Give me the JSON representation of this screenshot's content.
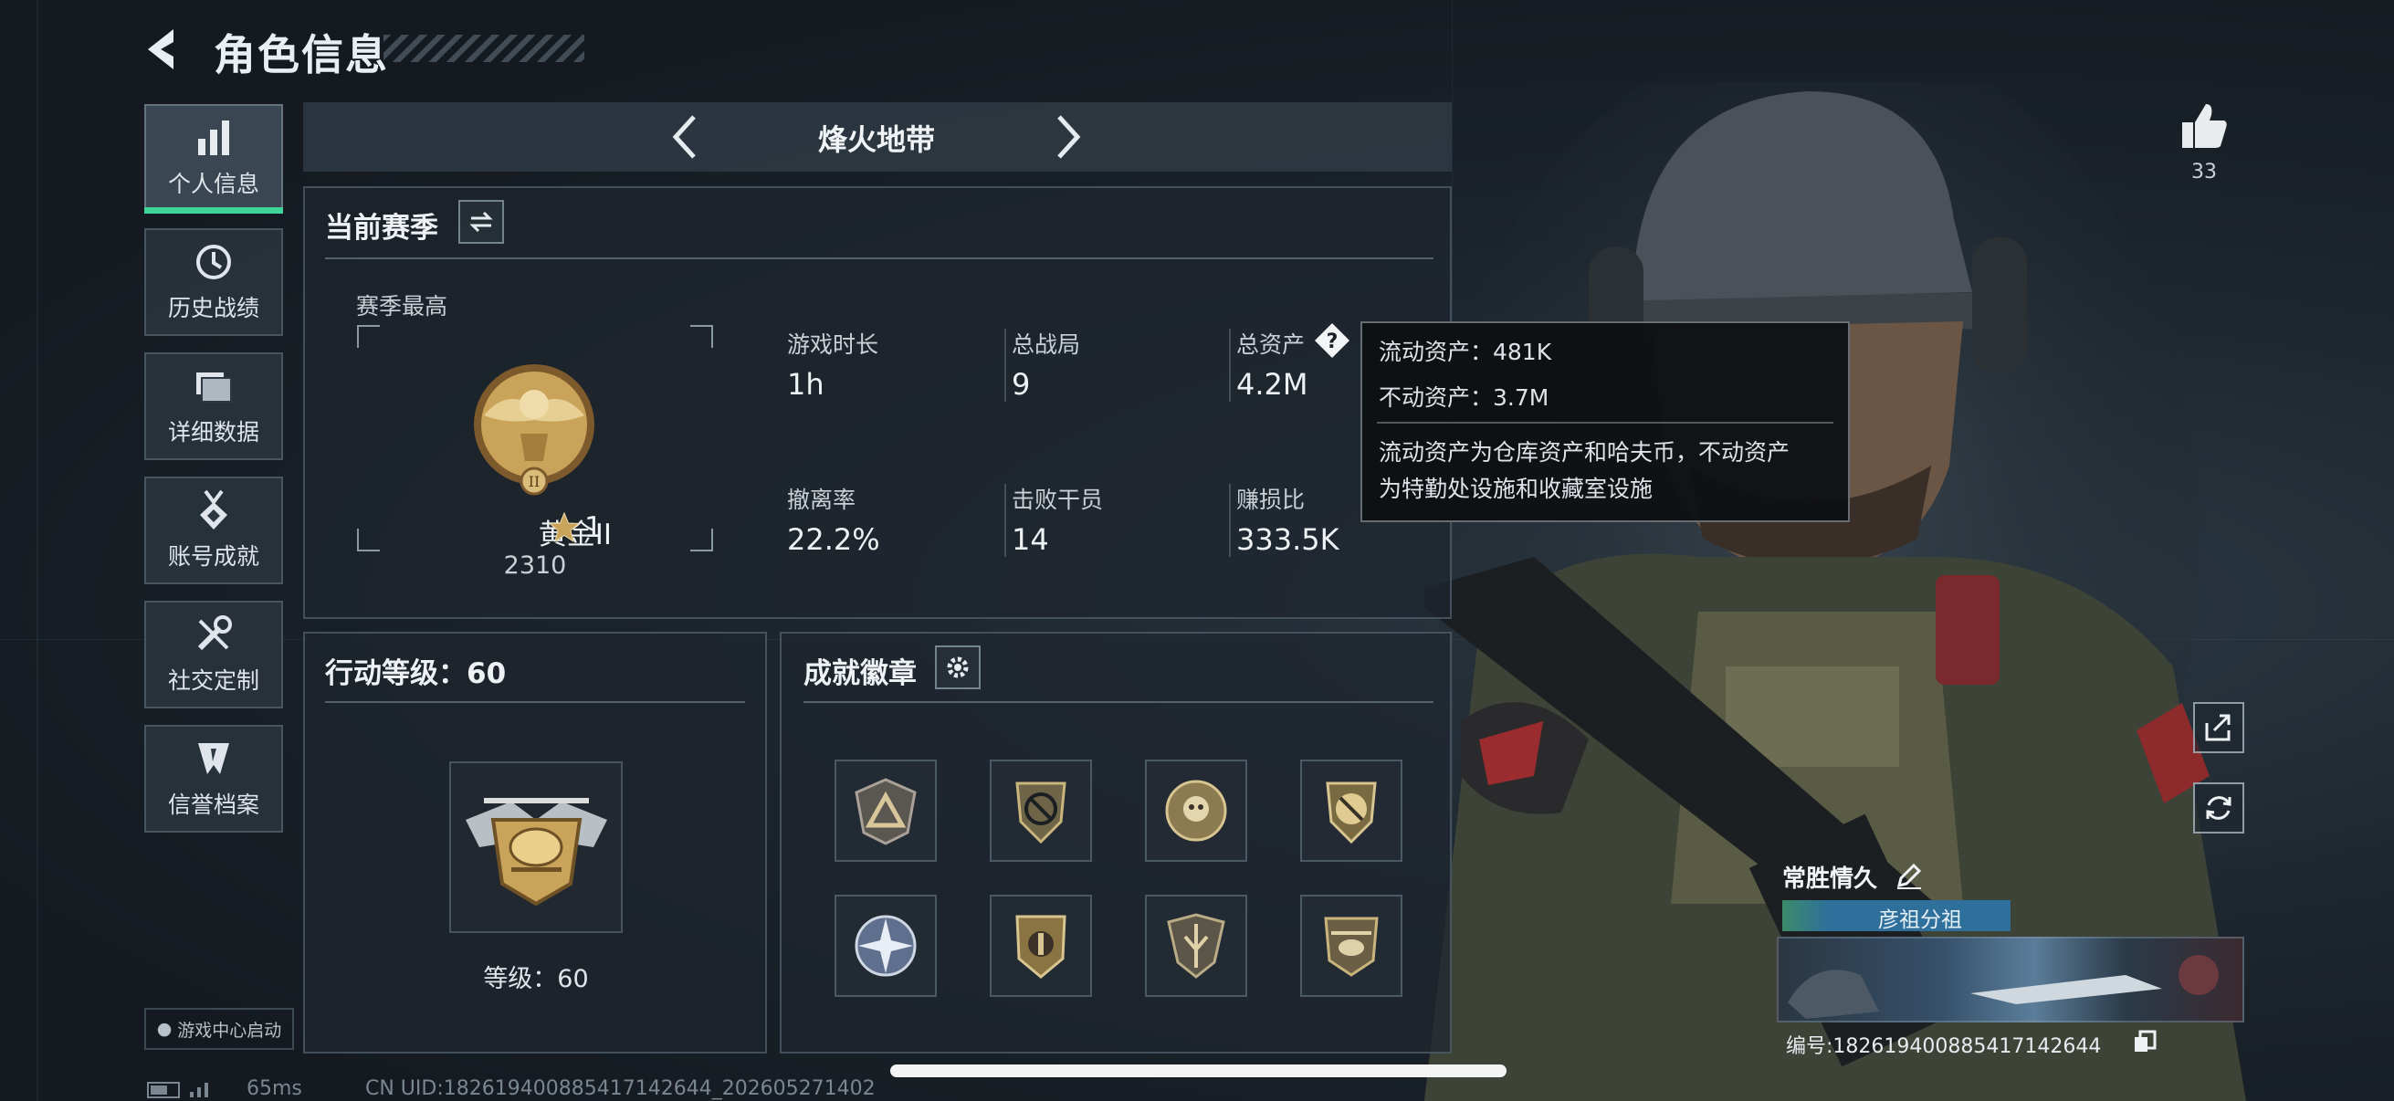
{
  "header": {
    "title": "角色信息"
  },
  "nav": {
    "items": [
      {
        "label": "个人信息",
        "icon": "bar-chart-icon",
        "active": true
      },
      {
        "label": "历史战绩",
        "icon": "clock-history-icon"
      },
      {
        "label": "详细数据",
        "icon": "folder-stack-icon"
      },
      {
        "label": "账号成就",
        "icon": "medal-icon"
      },
      {
        "label": "社交定制",
        "icon": "wrench-tools-icon"
      },
      {
        "label": "信誉档案",
        "icon": "reputation-badge-icon"
      }
    ],
    "game_center": "游戏中心启动"
  },
  "mode": {
    "title": "烽火地带"
  },
  "season": {
    "title": "当前赛季",
    "best_label": "赛季最高",
    "rank_name": "黄金II",
    "rank_stars": "1",
    "rank_score": "2310",
    "stats": [
      {
        "label": "游戏时长",
        "value": "1h"
      },
      {
        "label": "总战局",
        "value": "9"
      },
      {
        "label": "总资产",
        "value": "4.2M"
      },
      {
        "label": "撤离率",
        "value": "22.2%"
      },
      {
        "label": "击败干员",
        "value": "14"
      },
      {
        "label": "赚损比",
        "value": "333.5K"
      }
    ]
  },
  "tooltip": {
    "liquid": "流动资产：481K",
    "fixed": "不动资产：3.7M",
    "desc_line1": "流动资产为仓库资产和哈夫币，不动资产",
    "desc_line2": "为特勤处设施和收藏室设施"
  },
  "action_level": {
    "title": "行动等级：60",
    "level_text": "等级：60"
  },
  "achievements": {
    "title": "成就徽章",
    "badges": [
      "triangle-badge-icon",
      "no-gun-shield-badge-icon",
      "skull-wreath-badge-icon",
      "no-gun-emblem-badge-icon",
      "star-compass-badge-icon",
      "crest-shield-badge-icon",
      "winged-shield-badge-icon",
      "helicopter-badge-icon"
    ]
  },
  "profile": {
    "likes": "33",
    "player_name": "常胜情久",
    "tag": "彦祖分祖",
    "id_text": "编号:1826194008854171426​44"
  },
  "footer": {
    "ping": "65ms",
    "uid": "CN UID:182619400885417142644_202605271402"
  },
  "colors": {
    "accent_green": "#3fd59a",
    "tag_blue": "#2e6f9c",
    "gold": "#c9a35a"
  }
}
